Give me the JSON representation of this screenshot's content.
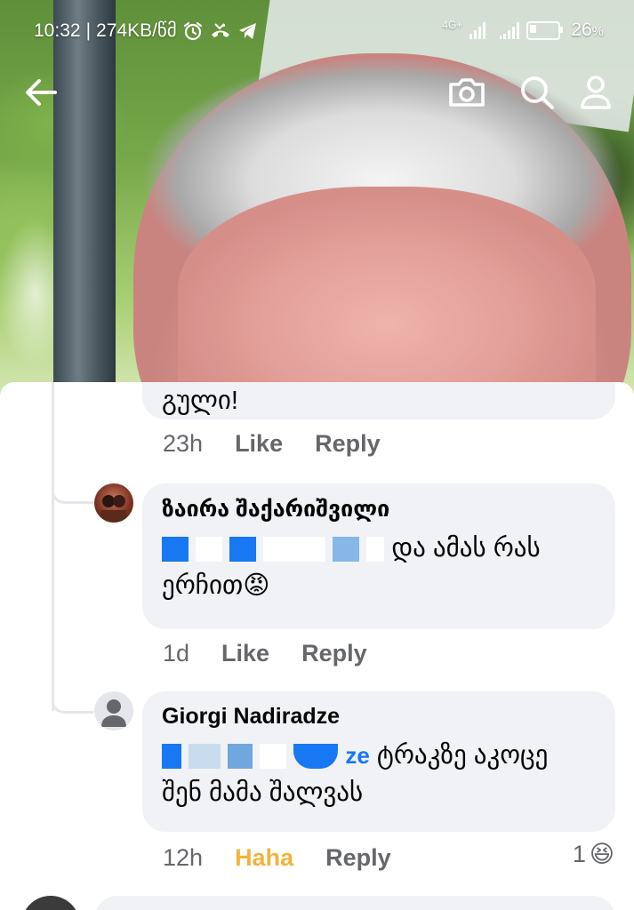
{
  "status_bar": {
    "time": "10:32",
    "net_speed": "274KB/წმ",
    "network_type": "4G+",
    "battery": "26",
    "battery_unit": "%"
  },
  "topbar": {
    "back_icon": "arrow-left-icon",
    "camera_icon": "camera-icon",
    "search_icon": "search-icon",
    "profile_icon": "person-icon"
  },
  "comments": [
    {
      "text": "გული!",
      "time": "23h",
      "like": "Like",
      "reply": "Reply"
    },
    {
      "author": "ზაირა შაქარიშვილი",
      "text_line1": "და ამას რას",
      "text_line2": "ერჩით",
      "emoji": "😡",
      "time": "1d",
      "like": "Like",
      "reply": "Reply"
    },
    {
      "author": "Giorgi Nadiradze",
      "mention_tail": "ze",
      "text_line1": "ტრაკზე აკოცე",
      "text_line2": "შენ მამა შალვას",
      "time": "12h",
      "reaction": "Haha",
      "reply": "Reply",
      "reaction_count": "1",
      "reaction_emoji": "😆"
    }
  ],
  "colors": {
    "haha": "#f2b33d",
    "mention": "#1877f2",
    "bubble": "#f0f2f5",
    "meta": "#65676b"
  }
}
